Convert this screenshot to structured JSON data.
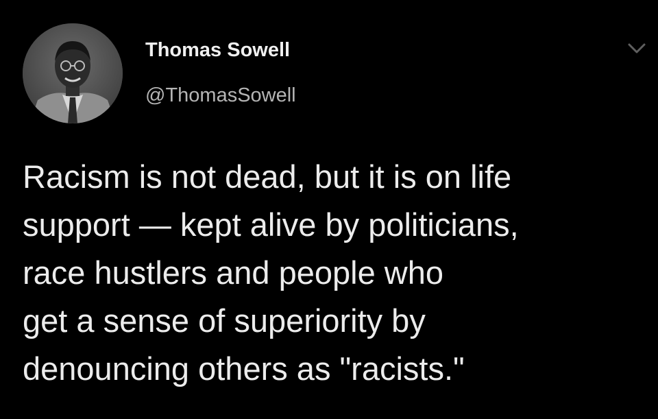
{
  "tweet": {
    "author": {
      "display_name": "Thomas Sowell",
      "handle": "@ThomasSowell",
      "avatar_icon": "profile-photo-grayscale"
    },
    "menu_icon": "chevron-down-icon",
    "text_lines": [
      "Racism is not dead, but it is on life",
      "support — kept alive by politicians,",
      "race hustlers and people who",
      "get a sense of superiority by",
      "denouncing others as \"racists.\""
    ]
  },
  "colors": {
    "background": "#000000",
    "name": "#f0f0f0",
    "handle": "#b5b5b5",
    "body_text": "#ececec",
    "caret": "#5f5f5f"
  }
}
